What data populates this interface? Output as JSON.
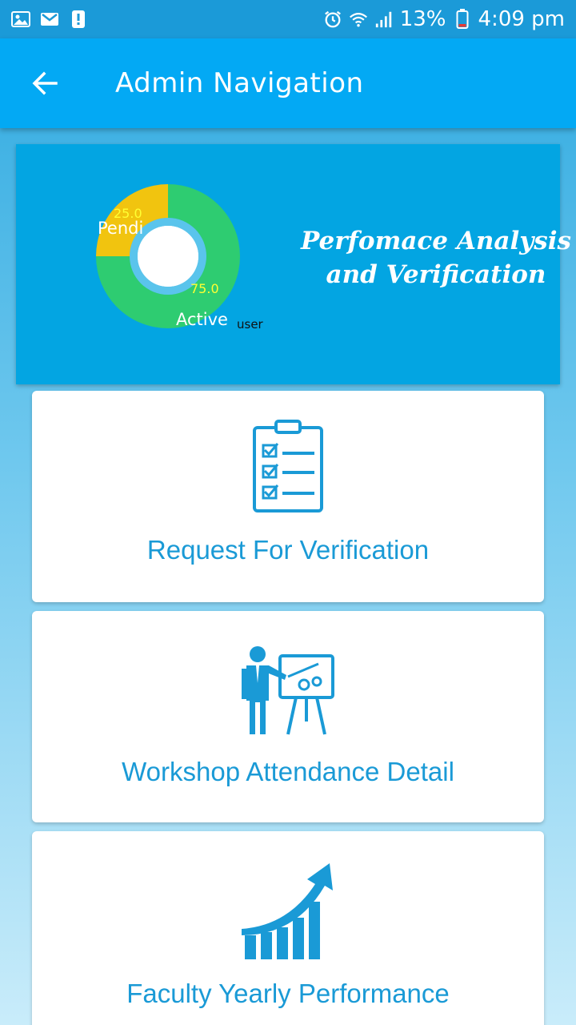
{
  "status_bar": {
    "left_icons": [
      "image-icon",
      "gmail-icon",
      "alert-icon"
    ],
    "right_icons": [
      "alarm-icon",
      "wifi-icon",
      "signal-icon"
    ],
    "battery": "13%",
    "time": "4:09 pm"
  },
  "app_bar": {
    "title": "Admin Navigation",
    "back_icon": "back-arrow-icon"
  },
  "banner": {
    "title_line1": "Perfomace Analysis",
    "title_line2": "and Verification"
  },
  "chart_data": {
    "type": "pie",
    "categories": [
      "Pending",
      "Active"
    ],
    "values": [
      25.0,
      75.0
    ],
    "value_labels": [
      "25.0",
      "75.0"
    ],
    "slice_labels": [
      "Pendi",
      "Active"
    ],
    "center_label": "user",
    "colors": [
      "#f1c40f",
      "#2ecc71"
    ]
  },
  "cards": [
    {
      "label": "Request For Verification",
      "icon": "clipboard-checklist-icon"
    },
    {
      "label": "Workshop Attendance Detail",
      "icon": "presenter-board-icon"
    },
    {
      "label": "Faculty Yearly Performance",
      "icon": "growth-chart-icon"
    }
  ],
  "colors": {
    "accent": "#03a9f4",
    "status_bar": "#1b9ad8",
    "card_text": "#1a9ad6"
  }
}
